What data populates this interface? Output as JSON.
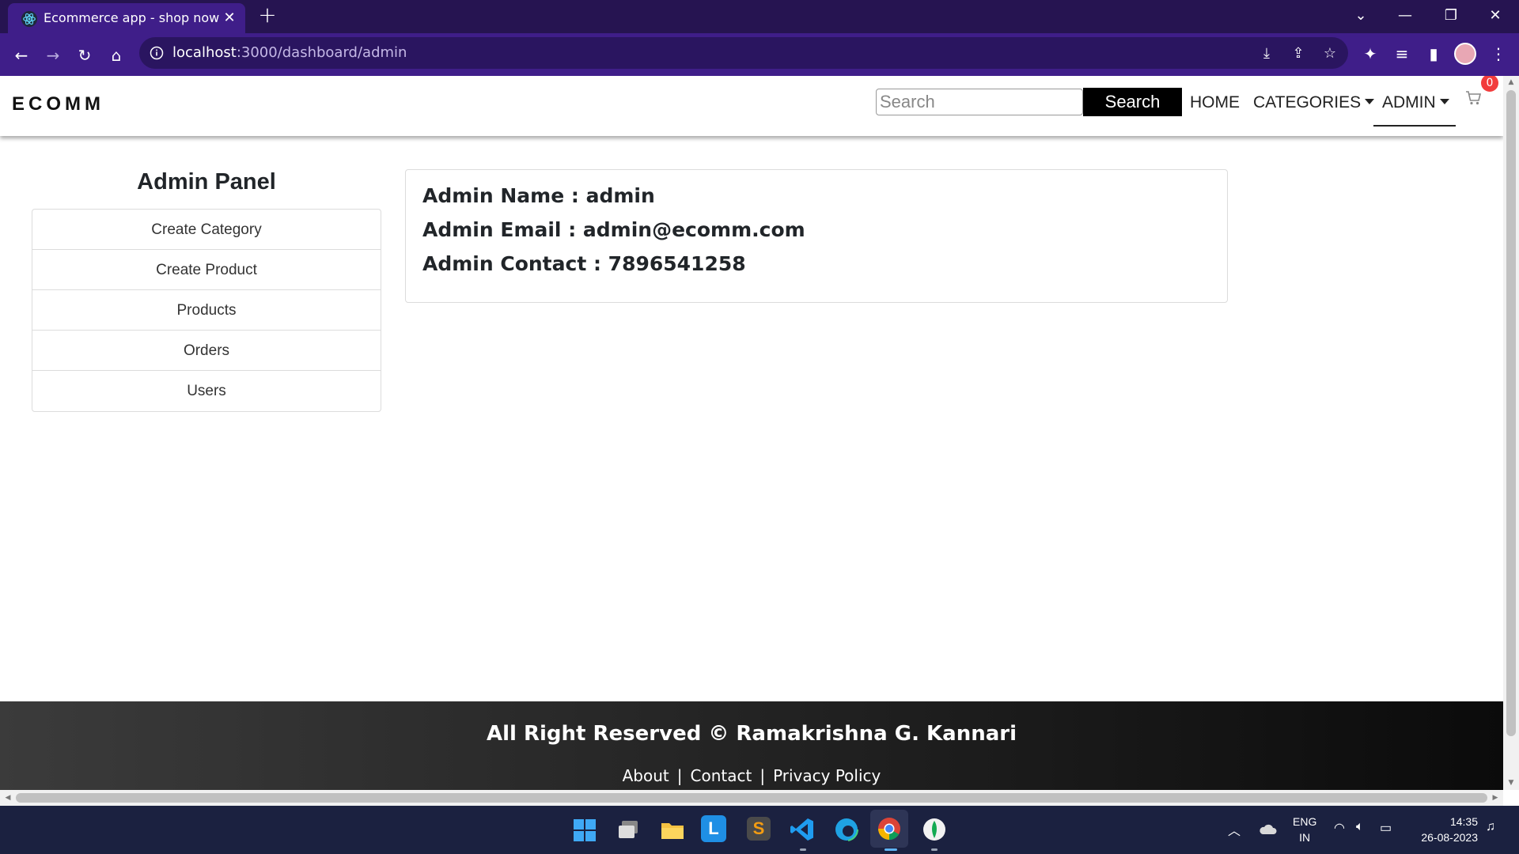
{
  "browser": {
    "tab_title": "Ecommerce app - shop now",
    "url_host": "localhost",
    "url_path": ":3000/dashboard/admin"
  },
  "site": {
    "brand": "ECOMM",
    "search_placeholder": "Search",
    "search_button": "Search",
    "nav": {
      "home": "HOME",
      "categories": "CATEGORIES",
      "admin": "ADMIN"
    },
    "cart_count": "0"
  },
  "sidebar": {
    "title": "Admin Panel",
    "items": [
      {
        "label": "Create Category"
      },
      {
        "label": "Create Product"
      },
      {
        "label": "Products"
      },
      {
        "label": "Orders"
      },
      {
        "label": "Users"
      }
    ]
  },
  "admin_info": {
    "name": "Admin Name : admin",
    "email": "Admin Email : admin@ecomm.com",
    "contact": "Admin Contact : 7896541258"
  },
  "footer": {
    "copyright": "All Right Reserved © Ramakrishna G. Kannari",
    "links": [
      "About",
      "Contact",
      "Privacy Policy"
    ]
  },
  "taskbar": {
    "lang": "ENG",
    "region": "IN",
    "time": "14:35",
    "date": "26-08-2023"
  },
  "colors": {
    "browser_frame": "#3f1e89",
    "tabstrip": "#261451",
    "taskbar": "#1b2140",
    "badge": "#f23c3c"
  }
}
